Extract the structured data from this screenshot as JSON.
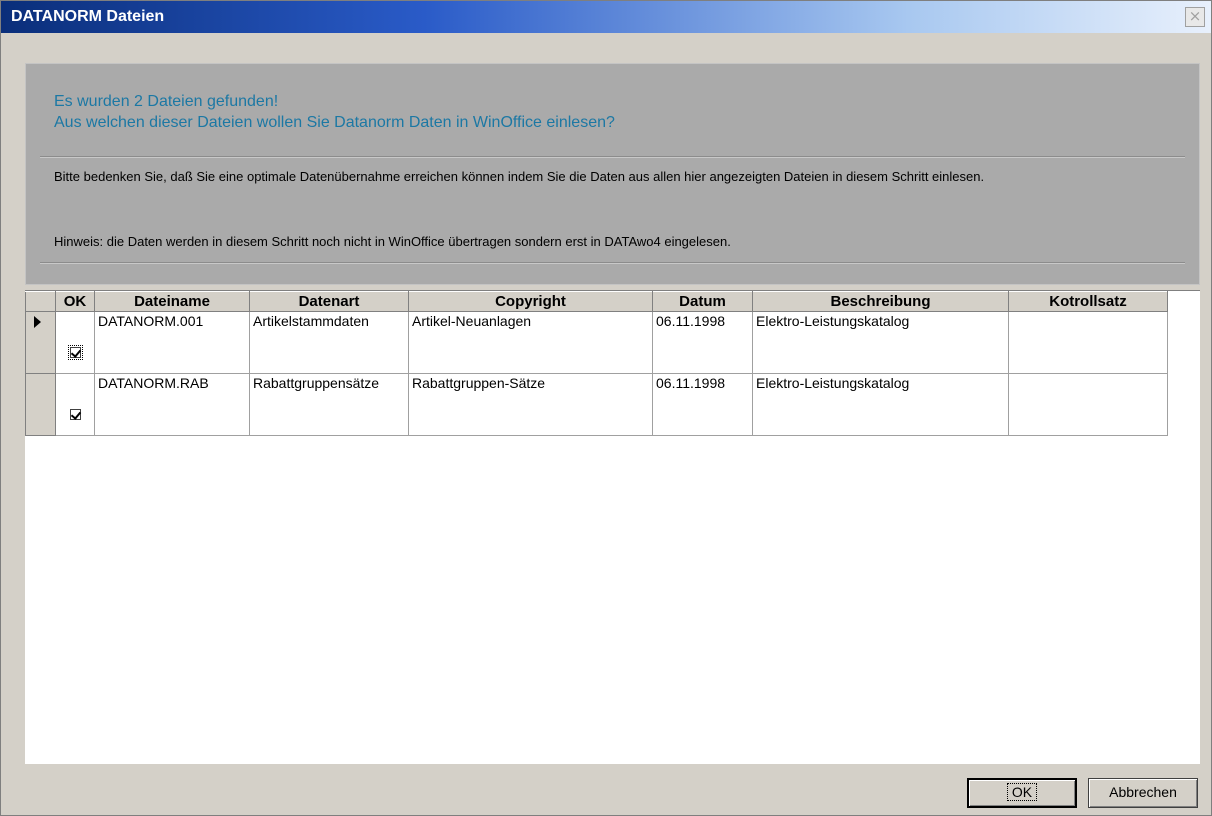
{
  "window": {
    "title": "DATANORM Dateien",
    "close_symbol": "×"
  },
  "panel": {
    "headline_1": "Es wurden 2 Dateien gefunden!",
    "headline_2": "Aus welchen dieser Dateien wollen Sie Datanorm Daten in WinOffice einlesen?",
    "info_text": "Bitte bedenken Sie, daß Sie eine optimale Datenübernahme erreichen können indem Sie die Daten aus allen hier angezeigten Dateien in diesem Schritt einlesen.",
    "hint_text": "Hinweis: die Daten werden in diesem Schritt noch nicht in WinOffice übertragen sondern erst in DATAwo4 eingelesen."
  },
  "grid": {
    "columns": [
      "OK",
      "Dateiname",
      "Datenart",
      "Copyright",
      "Datum",
      "Beschreibung",
      "Kotrollsatz"
    ],
    "rows": [
      {
        "ok": true,
        "dateiname": "DATANORM.001",
        "datenart": "Artikelstammdaten",
        "copyright": "Artikel-Neuanlagen",
        "datum": "06.11.1998",
        "beschreibung": "Elektro-Leistungskatalog",
        "kontrollsatz": ""
      },
      {
        "ok": true,
        "dateiname": "DATANORM.RAB",
        "datenart": "Rabattgruppensätze",
        "copyright": "Rabattgruppen-Sätze",
        "datum": "06.11.1998",
        "beschreibung": "Elektro-Leistungskatalog",
        "kontrollsatz": ""
      }
    ]
  },
  "buttons": {
    "ok_label": "OK",
    "cancel_label": "Abbrechen"
  }
}
